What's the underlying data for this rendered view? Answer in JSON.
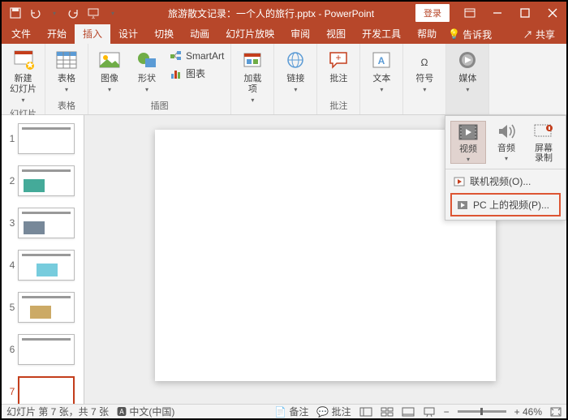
{
  "titlebar": {
    "filename": "旅游散文记录：一个人的旅行.pptx",
    "app_name": "PowerPoint",
    "login": "登录"
  },
  "tabs": {
    "file": "文件",
    "home": "开始",
    "insert": "插入",
    "design": "设计",
    "transitions": "切换",
    "animations": "动画",
    "slideshow": "幻灯片放映",
    "review": "审阅",
    "view": "视图",
    "developer": "开发工具",
    "help": "帮助",
    "tellme": "告诉我",
    "share": "共享"
  },
  "ribbon": {
    "slide": {
      "new_slide": "新建\n幻灯片",
      "group": "幻灯片"
    },
    "table": {
      "btn": "表格",
      "group": "表格"
    },
    "illustrations": {
      "images": "图像",
      "shapes": "形状",
      "smartart": "SmartArt",
      "chart": "图表",
      "group": "插图"
    },
    "addins": {
      "btn": "加载\n项"
    },
    "links": {
      "btn": "链接"
    },
    "comments": {
      "btn": "批注",
      "group": "批注"
    },
    "text": {
      "btn": "文本"
    },
    "symbols": {
      "btn": "符号"
    },
    "media": {
      "btn": "媒体"
    }
  },
  "media_panel": {
    "video": "视频",
    "audio": "音频",
    "screen": "屏幕\n录制",
    "online_video": "联机视频(O)...",
    "pc_video": "PC 上的视频(P)..."
  },
  "thumbs": [
    "1",
    "2",
    "3",
    "4",
    "5",
    "6",
    "7"
  ],
  "status": {
    "slide_counter": "幻灯片 第 7 张，共 7 张",
    "lang": "中文(中国)",
    "notes": "备注",
    "comments": "批注",
    "zoom": "+ 46%"
  }
}
